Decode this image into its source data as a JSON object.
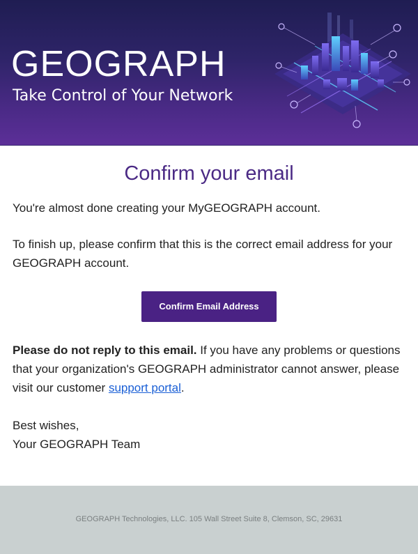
{
  "banner": {
    "brand": "GEOGRAPH",
    "tagline": "Take Control of Your Network"
  },
  "email": {
    "heading": "Confirm your email",
    "line1": "You're almost done creating your MyGEOGRAPH account.",
    "line2": "To finish up, please confirm that this is the correct email address for your GEOGRAPH account.",
    "confirm_button": "Confirm Email Address",
    "notice_bold": "Please do not reply to this email.",
    "notice_rest": " If you have any problems or questions that your organization's GEOGRAPH administrator cannot answer, please visit our customer ",
    "support_link": "support portal",
    "notice_end": ".",
    "closing": "Best wishes,",
    "signature": "Your GEOGRAPH Team"
  },
  "footer": {
    "address": "GEOGRAPH Technologies, LLC. 105 Wall Street Suite 8, Clemson, SC, 29631"
  },
  "colors": {
    "heading": "#4b2a85",
    "button": "#4a2284",
    "link": "#1a5fd6",
    "footer_bg": "#c9d0d0"
  }
}
